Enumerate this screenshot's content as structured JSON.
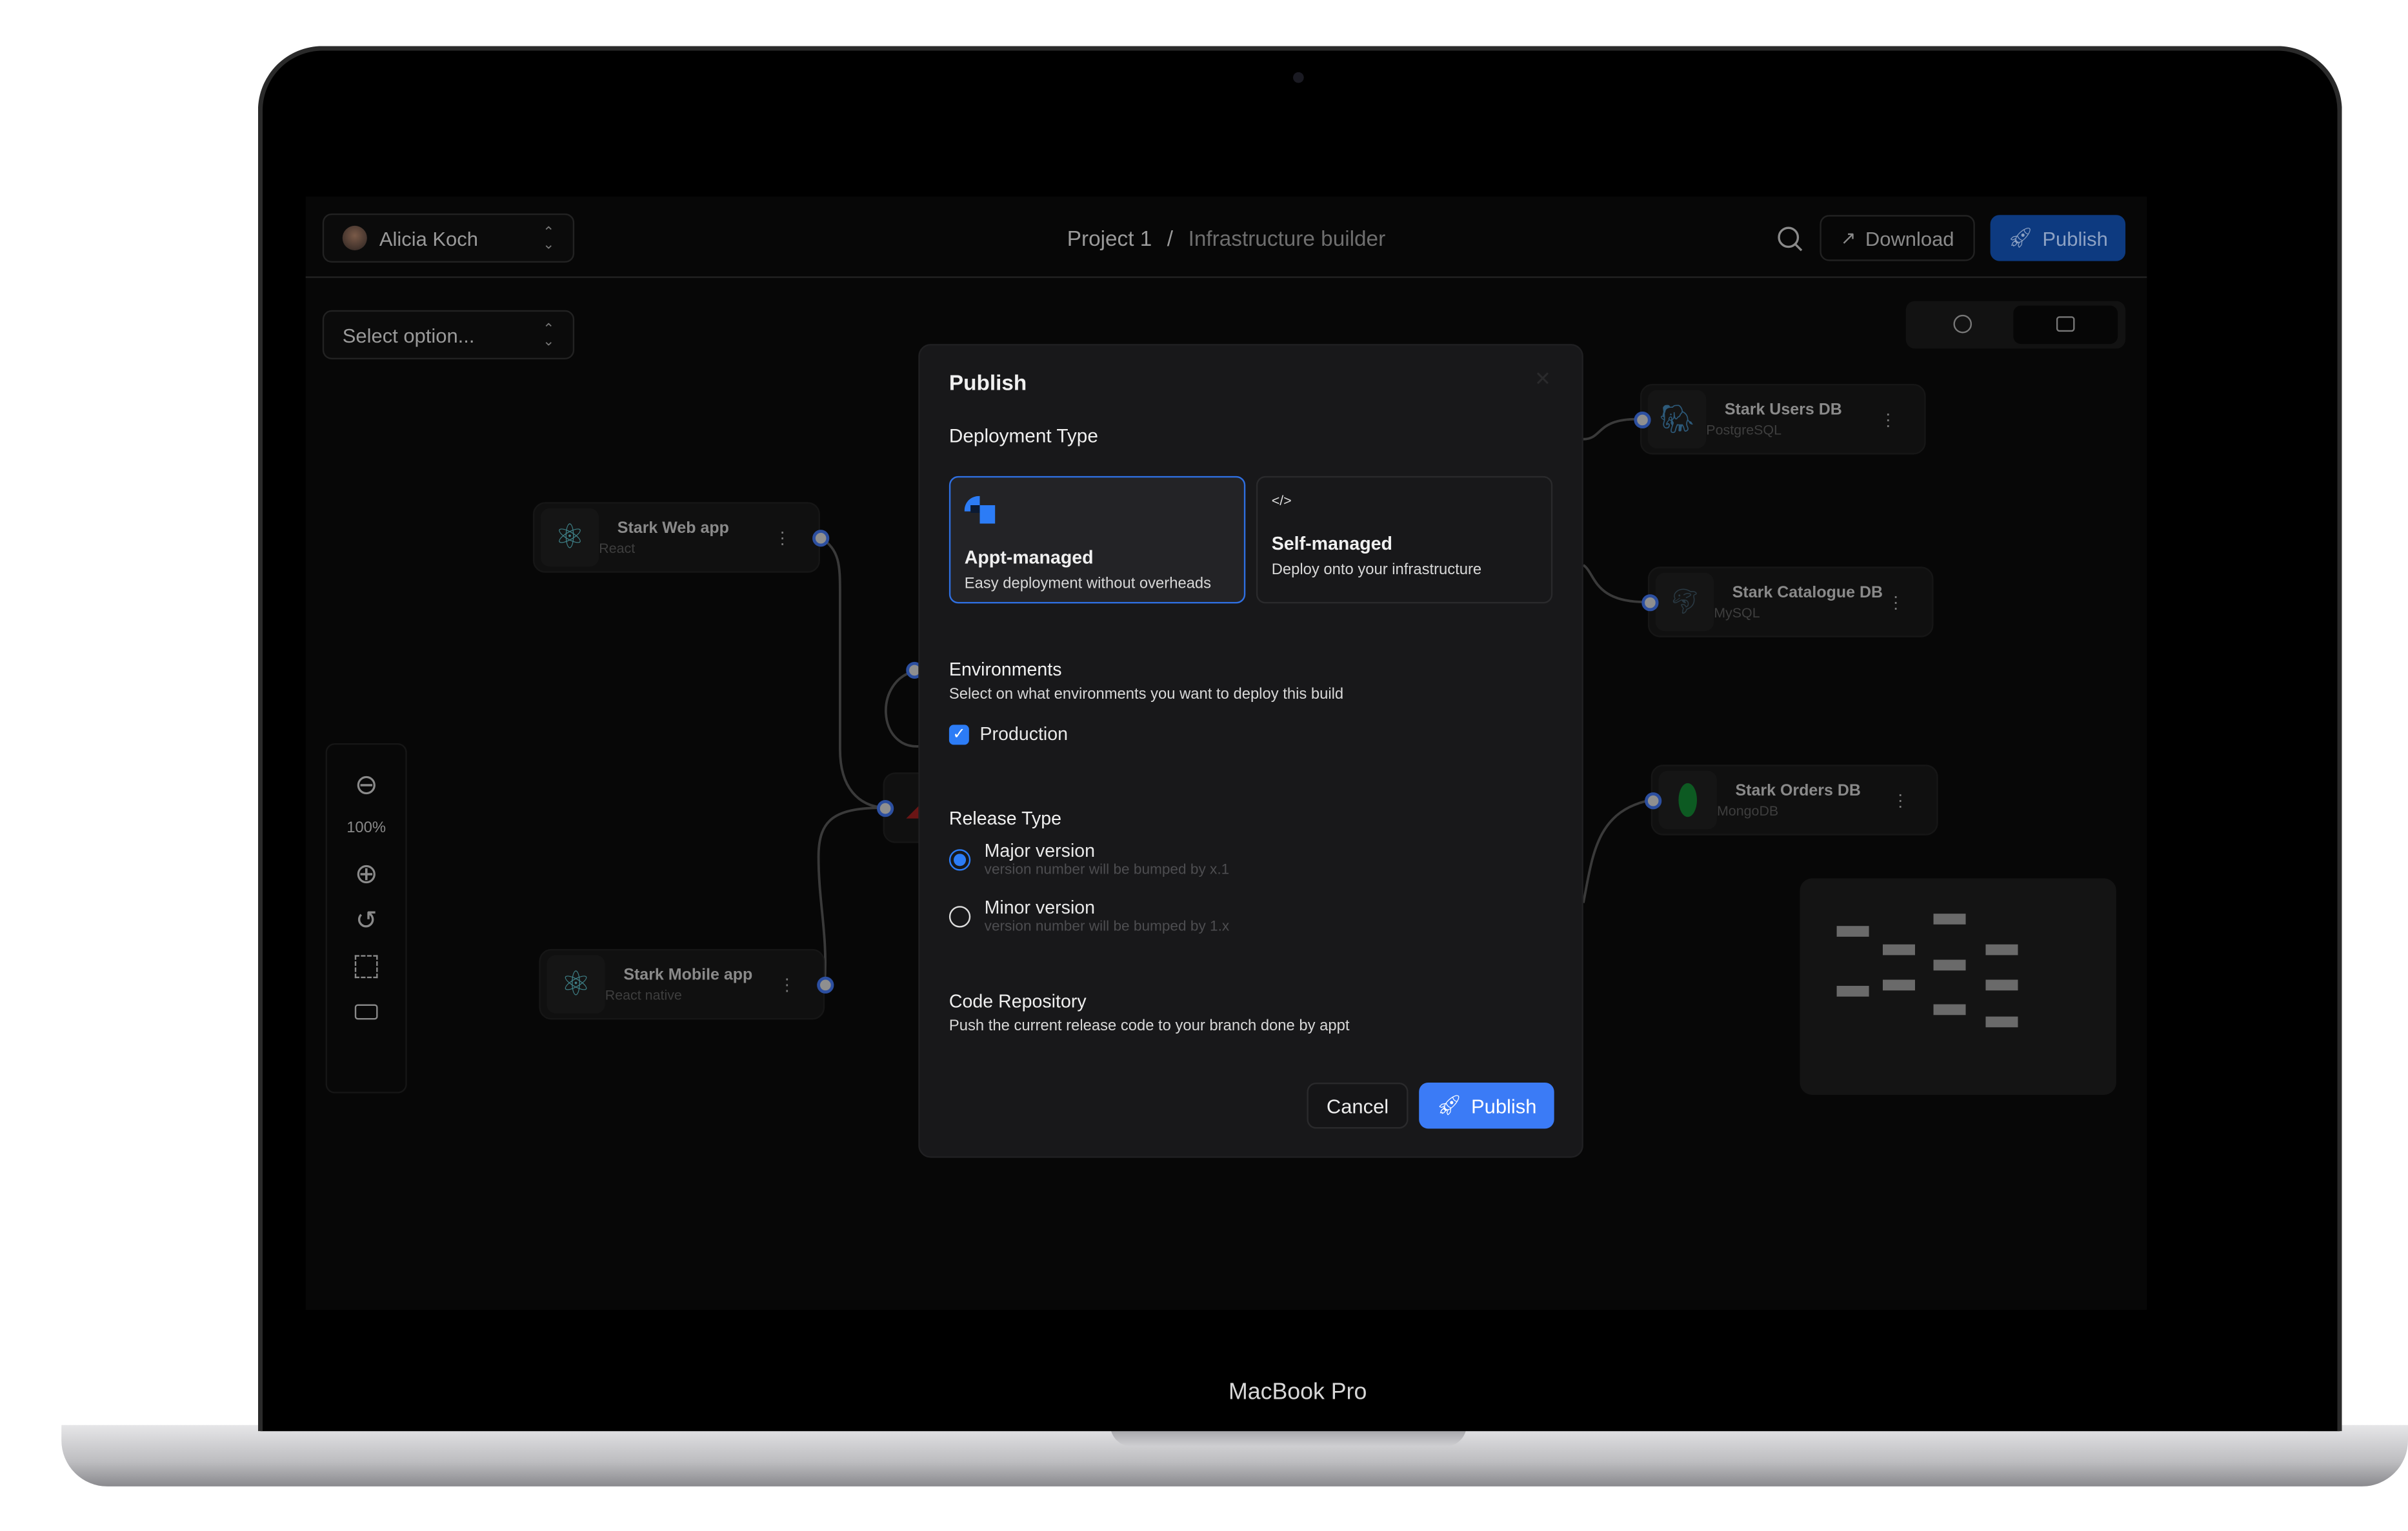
{
  "device": {
    "label": "MacBook Pro"
  },
  "header": {
    "user": "Alicia Koch",
    "breadcrumb": {
      "project": "Project 1",
      "separator": "/",
      "page": "Infrastructure builder"
    },
    "download_label": "Download",
    "publish_label": "Publish"
  },
  "toolbar": {
    "select_placeholder": "Select option...",
    "zoom_level": "100%"
  },
  "nodes": [
    {
      "title": "Stark Web app",
      "subtitle": "React",
      "icon": "react-icon"
    },
    {
      "title": "Stark Mobile app",
      "subtitle": "React native",
      "icon": "react-icon"
    },
    {
      "title": "Stark Users DB",
      "subtitle": "PostgreSQL",
      "icon": "postgresql-icon"
    },
    {
      "title": "Stark Catalogue DB",
      "subtitle": "MySQL",
      "icon": "mysql-icon"
    },
    {
      "title": "Stark Orders DB",
      "subtitle": "MongoDB",
      "icon": "mongodb-icon"
    }
  ],
  "modal": {
    "title": "Publish",
    "deployment_type": {
      "label": "Deployment Type",
      "options": [
        {
          "title": "Appt-managed",
          "desc": "Easy deployment without overheads",
          "selected": true
        },
        {
          "title": "Self-managed",
          "desc": "Deploy onto your infrastructure",
          "selected": false
        }
      ]
    },
    "environments": {
      "label": "Environments",
      "desc": "Select on what environments you want to deploy this build",
      "options": [
        {
          "label": "Production",
          "checked": true
        }
      ]
    },
    "release_type": {
      "label": "Release Type",
      "options": [
        {
          "label": "Major version",
          "desc": "version number will be bumped by x.1",
          "selected": true
        },
        {
          "label": "Minor version",
          "desc": "version number will be bumped by 1.x",
          "selected": false
        }
      ]
    },
    "code_repository": {
      "label": "Code Repository",
      "desc": "Push the current release code to your branch done by appt"
    },
    "cancel_label": "Cancel",
    "publish_label": "Publish"
  },
  "colors": {
    "accent": "#3b7bf6",
    "header_publish": "#0d3a80",
    "selected_border": "#2f6fe0"
  }
}
